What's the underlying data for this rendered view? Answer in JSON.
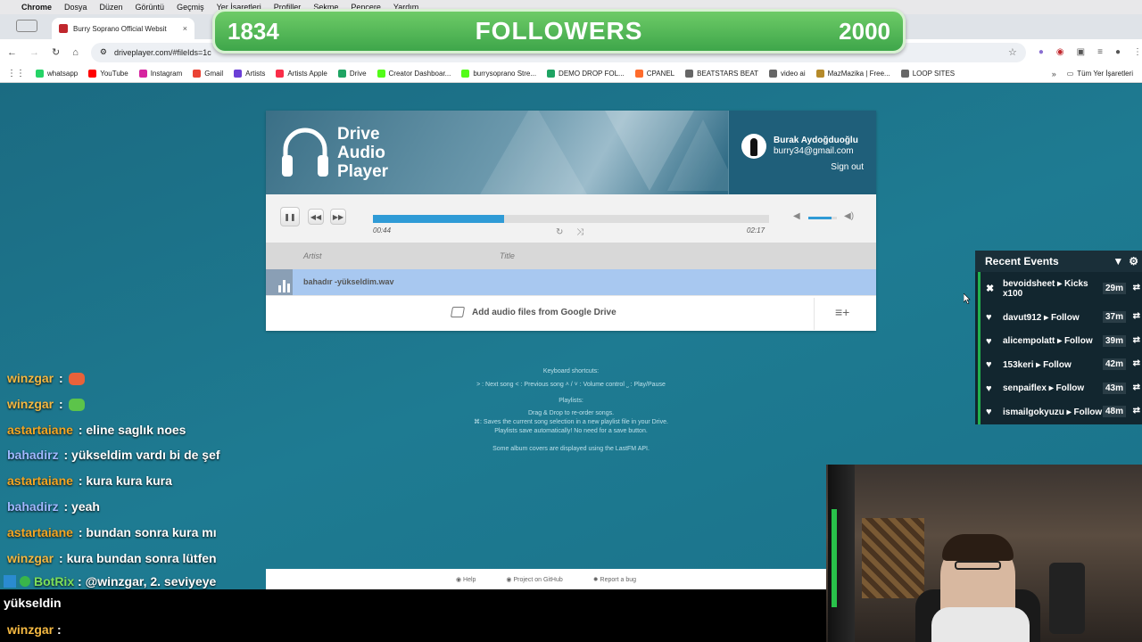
{
  "menubar": {
    "items": [
      "Chrome",
      "Dosya",
      "Düzen",
      "Görüntü",
      "Geçmiş",
      "Yer İşaretleri",
      "Profiller",
      "Sekme",
      "Pencere",
      "Yardım"
    ]
  },
  "tab": {
    "title": "Burry Soprano Official Websit",
    "close": "×"
  },
  "omnibox": {
    "url": "driveplayer.com/#fileIds=1c"
  },
  "bookmarks": {
    "items": [
      {
        "label": "whatsapp",
        "color": "#25d366"
      },
      {
        "label": "YouTube",
        "color": "#ff0000"
      },
      {
        "label": "Instagram",
        "color": "#d6249f"
      },
      {
        "label": "Gmail",
        "color": "#ea4335"
      },
      {
        "label": "Artists",
        "color": "#6b3fd6"
      },
      {
        "label": "Artists Apple",
        "color": "#fa2d48"
      },
      {
        "label": "Drive",
        "color": "#1fa463"
      },
      {
        "label": "Creator Dashboar...",
        "color": "#53fc18"
      },
      {
        "label": "burrysoprano Stre...",
        "color": "#53fc18"
      },
      {
        "label": "DEMO DROP FOL...",
        "color": "#1fa463"
      },
      {
        "label": "CPANEL",
        "color": "#ff6c2c"
      },
      {
        "label": "BEATSTARS BEAT",
        "color": "#666666"
      },
      {
        "label": "video ai",
        "color": "#666666"
      },
      {
        "label": "MazMazika | Free...",
        "color": "#b58a2a"
      },
      {
        "label": "LOOP SITES",
        "color": "#666666"
      }
    ],
    "more": "»",
    "all": "Tüm Yer İşaretleri"
  },
  "followers": {
    "current": "1834",
    "label": "FOLLOWERS",
    "goal": "2000"
  },
  "player": {
    "brand_line1": "Drive",
    "brand_line2": "Audio",
    "brand_line3": "Player",
    "user_name": "Burak Aydoğduoğlu",
    "user_email": "burry34@gmail.com",
    "sign_out": "Sign out",
    "time_current": "00:44",
    "time_total": "02:17",
    "progress": 0.33,
    "volume": 0.8,
    "col_artist": "Artist",
    "col_title": "Title",
    "track": "bahadır -yükseldim.wav",
    "add_files": "Add audio files from Google Drive"
  },
  "info": {
    "kb_title": "Keyboard shortcuts:",
    "kb_line": "˃ : Next song  ˂ : Previous song  ˄ / ˅ : Volume control  ˽ : Play/Pause",
    "pl_title": "Playlists:",
    "pl_line1": "Drag & Drop to re-order songs.",
    "pl_line2": "⌘: Saves the current song selection in a new playlist file in your Drive.",
    "pl_line3": "Playlists save automatically! No need for a save button.",
    "album_line": "Some album covers are displayed using the LastFM API."
  },
  "footer": {
    "help": "Help",
    "github": "Project on GitHub",
    "bug": "Report a bug"
  },
  "chat": [
    {
      "user": "winzgar",
      "color": "#f5b942",
      "text": "",
      "emoji": "#e8623a"
    },
    {
      "user": "winzgar",
      "color": "#f5b942",
      "text": "",
      "emoji": "#5cc44a"
    },
    {
      "user": "astartaiane",
      "color": "#f5a623",
      "text": "eline saglık noes"
    },
    {
      "user": "bahadirz",
      "color": "#9fb8ff",
      "text": "yükseldim vardı bi de şef"
    },
    {
      "user": "astartaiane",
      "color": "#f5a623",
      "text": "kura kura kura"
    },
    {
      "user": "bahadirz",
      "color": "#9fb8ff",
      "text": "yeah"
    },
    {
      "user": "astartaiane",
      "color": "#f5a623",
      "text": "bundan sonra kura mı"
    },
    {
      "user": "winzgar",
      "color": "#f5b942",
      "text": "kura bundan sonra lütfen"
    }
  ],
  "bot": {
    "user": "BotRix",
    "color": "#7ee05a",
    "text": "@winzgar, 2. seviyeye",
    "text2": "yükseldin"
  },
  "chat_last": {
    "user": "winzgar",
    "color": "#f5b942",
    "emoji": "#e8623a"
  },
  "events": {
    "title": "Recent Events",
    "items": [
      {
        "name": "bevoidsheet",
        "action": "Kicks x100",
        "time": "29m",
        "kind": "kick"
      },
      {
        "name": "davut912",
        "action": "Follow",
        "time": "37m",
        "kind": "follow"
      },
      {
        "name": "alicempolatt",
        "action": "Follow",
        "time": "39m",
        "kind": "follow"
      },
      {
        "name": "153keri",
        "action": "Follow",
        "time": "42m",
        "kind": "follow"
      },
      {
        "name": "senpaiflex",
        "action": "Follow",
        "time": "43m",
        "kind": "follow"
      },
      {
        "name": "ismailgokyuzu",
        "action": "Follow",
        "time": "48m",
        "kind": "follow"
      }
    ]
  }
}
